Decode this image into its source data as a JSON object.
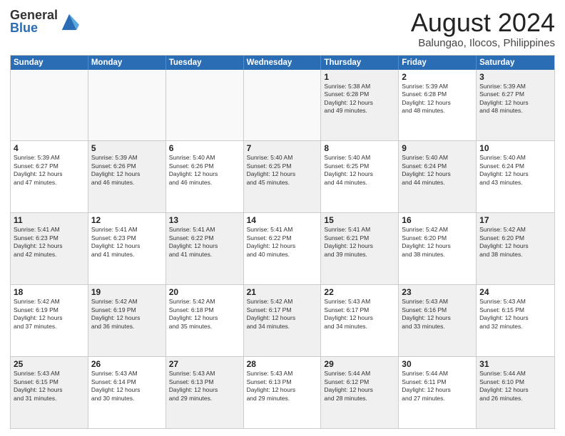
{
  "logo": {
    "general": "General",
    "blue": "Blue"
  },
  "title": {
    "month": "August 2024",
    "location": "Balungao, Ilocos, Philippines"
  },
  "weekdays": [
    "Sunday",
    "Monday",
    "Tuesday",
    "Wednesday",
    "Thursday",
    "Friday",
    "Saturday"
  ],
  "rows": [
    [
      {
        "day": "",
        "text": "",
        "empty": true
      },
      {
        "day": "",
        "text": "",
        "empty": true
      },
      {
        "day": "",
        "text": "",
        "empty": true
      },
      {
        "day": "",
        "text": "",
        "empty": true
      },
      {
        "day": "1",
        "text": "Sunrise: 5:38 AM\nSunset: 6:28 PM\nDaylight: 12 hours\nand 49 minutes.",
        "shaded": true
      },
      {
        "day": "2",
        "text": "Sunrise: 5:39 AM\nSunset: 6:28 PM\nDaylight: 12 hours\nand 48 minutes.",
        "shaded": false
      },
      {
        "day": "3",
        "text": "Sunrise: 5:39 AM\nSunset: 6:27 PM\nDaylight: 12 hours\nand 48 minutes.",
        "shaded": true
      }
    ],
    [
      {
        "day": "4",
        "text": "Sunrise: 5:39 AM\nSunset: 6:27 PM\nDaylight: 12 hours\nand 47 minutes.",
        "shaded": false
      },
      {
        "day": "5",
        "text": "Sunrise: 5:39 AM\nSunset: 6:26 PM\nDaylight: 12 hours\nand 46 minutes.",
        "shaded": true
      },
      {
        "day": "6",
        "text": "Sunrise: 5:40 AM\nSunset: 6:26 PM\nDaylight: 12 hours\nand 46 minutes.",
        "shaded": false
      },
      {
        "day": "7",
        "text": "Sunrise: 5:40 AM\nSunset: 6:25 PM\nDaylight: 12 hours\nand 45 minutes.",
        "shaded": true
      },
      {
        "day": "8",
        "text": "Sunrise: 5:40 AM\nSunset: 6:25 PM\nDaylight: 12 hours\nand 44 minutes.",
        "shaded": false
      },
      {
        "day": "9",
        "text": "Sunrise: 5:40 AM\nSunset: 6:24 PM\nDaylight: 12 hours\nand 44 minutes.",
        "shaded": true
      },
      {
        "day": "10",
        "text": "Sunrise: 5:40 AM\nSunset: 6:24 PM\nDaylight: 12 hours\nand 43 minutes.",
        "shaded": false
      }
    ],
    [
      {
        "day": "11",
        "text": "Sunrise: 5:41 AM\nSunset: 6:23 PM\nDaylight: 12 hours\nand 42 minutes.",
        "shaded": true
      },
      {
        "day": "12",
        "text": "Sunrise: 5:41 AM\nSunset: 6:23 PM\nDaylight: 12 hours\nand 41 minutes.",
        "shaded": false
      },
      {
        "day": "13",
        "text": "Sunrise: 5:41 AM\nSunset: 6:22 PM\nDaylight: 12 hours\nand 41 minutes.",
        "shaded": true
      },
      {
        "day": "14",
        "text": "Sunrise: 5:41 AM\nSunset: 6:22 PM\nDaylight: 12 hours\nand 40 minutes.",
        "shaded": false
      },
      {
        "day": "15",
        "text": "Sunrise: 5:41 AM\nSunset: 6:21 PM\nDaylight: 12 hours\nand 39 minutes.",
        "shaded": true
      },
      {
        "day": "16",
        "text": "Sunrise: 5:42 AM\nSunset: 6:20 PM\nDaylight: 12 hours\nand 38 minutes.",
        "shaded": false
      },
      {
        "day": "17",
        "text": "Sunrise: 5:42 AM\nSunset: 6:20 PM\nDaylight: 12 hours\nand 38 minutes.",
        "shaded": true
      }
    ],
    [
      {
        "day": "18",
        "text": "Sunrise: 5:42 AM\nSunset: 6:19 PM\nDaylight: 12 hours\nand 37 minutes.",
        "shaded": false
      },
      {
        "day": "19",
        "text": "Sunrise: 5:42 AM\nSunset: 6:19 PM\nDaylight: 12 hours\nand 36 minutes.",
        "shaded": true
      },
      {
        "day": "20",
        "text": "Sunrise: 5:42 AM\nSunset: 6:18 PM\nDaylight: 12 hours\nand 35 minutes.",
        "shaded": false
      },
      {
        "day": "21",
        "text": "Sunrise: 5:42 AM\nSunset: 6:17 PM\nDaylight: 12 hours\nand 34 minutes.",
        "shaded": true
      },
      {
        "day": "22",
        "text": "Sunrise: 5:43 AM\nSunset: 6:17 PM\nDaylight: 12 hours\nand 34 minutes.",
        "shaded": false
      },
      {
        "day": "23",
        "text": "Sunrise: 5:43 AM\nSunset: 6:16 PM\nDaylight: 12 hours\nand 33 minutes.",
        "shaded": true
      },
      {
        "day": "24",
        "text": "Sunrise: 5:43 AM\nSunset: 6:15 PM\nDaylight: 12 hours\nand 32 minutes.",
        "shaded": false
      }
    ],
    [
      {
        "day": "25",
        "text": "Sunrise: 5:43 AM\nSunset: 6:15 PM\nDaylight: 12 hours\nand 31 minutes.",
        "shaded": true
      },
      {
        "day": "26",
        "text": "Sunrise: 5:43 AM\nSunset: 6:14 PM\nDaylight: 12 hours\nand 30 minutes.",
        "shaded": false
      },
      {
        "day": "27",
        "text": "Sunrise: 5:43 AM\nSunset: 6:13 PM\nDaylight: 12 hours\nand 29 minutes.",
        "shaded": true
      },
      {
        "day": "28",
        "text": "Sunrise: 5:43 AM\nSunset: 6:13 PM\nDaylight: 12 hours\nand 29 minutes.",
        "shaded": false
      },
      {
        "day": "29",
        "text": "Sunrise: 5:44 AM\nSunset: 6:12 PM\nDaylight: 12 hours\nand 28 minutes.",
        "shaded": true
      },
      {
        "day": "30",
        "text": "Sunrise: 5:44 AM\nSunset: 6:11 PM\nDaylight: 12 hours\nand 27 minutes.",
        "shaded": false
      },
      {
        "day": "31",
        "text": "Sunrise: 5:44 AM\nSunset: 6:10 PM\nDaylight: 12 hours\nand 26 minutes.",
        "shaded": true
      }
    ]
  ]
}
